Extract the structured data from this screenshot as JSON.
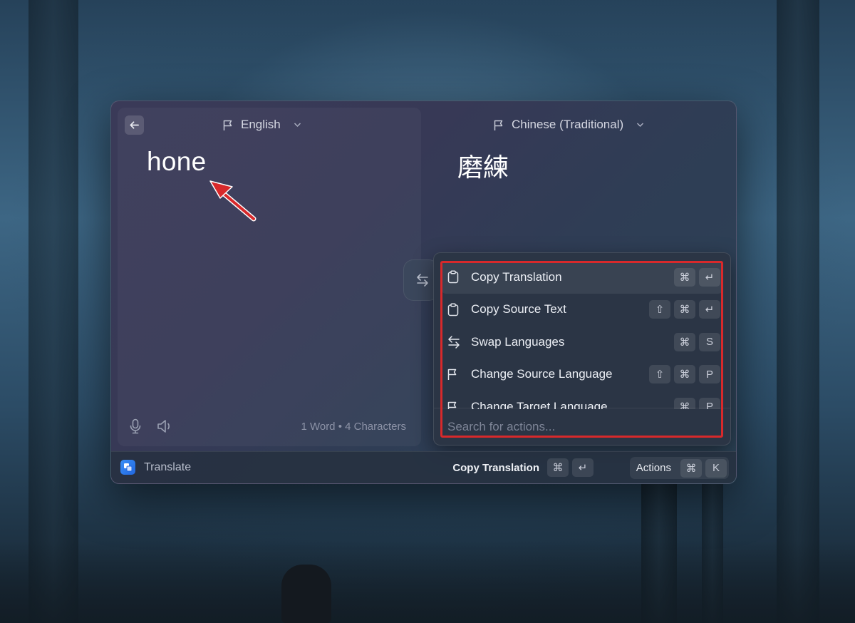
{
  "window": {
    "source_language": "English",
    "target_language": "Chinese (Traditional)",
    "source_text": "hone",
    "translated_text": "磨練",
    "counts": "1 Word • 4 Characters"
  },
  "actions_panel": {
    "items": [
      {
        "label": "Copy Translation",
        "icon": "clipboard-icon",
        "keys": [
          "⌘",
          "↵"
        ],
        "selected": true
      },
      {
        "label": "Copy Source Text",
        "icon": "clipboard-icon",
        "keys": [
          "⇧",
          "⌘",
          "↵"
        ]
      },
      {
        "label": "Swap Languages",
        "icon": "swap-arrows-icon",
        "keys": [
          "⌘",
          "S"
        ]
      },
      {
        "label": "Change Source Language",
        "icon": "flag-icon",
        "keys": [
          "⇧",
          "⌘",
          "P"
        ]
      },
      {
        "label": "Change Target Language",
        "icon": "flag-icon",
        "keys": [
          "⌘",
          "P"
        ]
      }
    ],
    "search_placeholder": "Search for actions..."
  },
  "footer": {
    "app_title": "Translate",
    "primary_action_label": "Copy Translation",
    "primary_keys": [
      "⌘",
      "↵"
    ],
    "actions_label": "Actions",
    "actions_keys": [
      "⌘",
      "K"
    ]
  },
  "colors": {
    "highlight": "#d8292b",
    "app_icon": "#2f7ef0"
  }
}
